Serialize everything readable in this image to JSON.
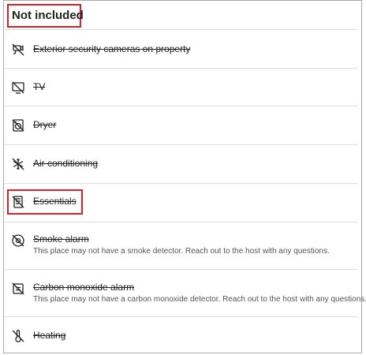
{
  "section": {
    "title": "Not included"
  },
  "items": [
    {
      "label": "Exterior security cameras on property",
      "icon": "camera-off-icon"
    },
    {
      "label": "TV",
      "icon": "tv-off-icon"
    },
    {
      "label": "Dryer",
      "icon": "dryer-off-icon"
    },
    {
      "label": "Air conditioning",
      "icon": "snowflake-off-icon"
    },
    {
      "label": "Essentials",
      "icon": "essentials-off-icon"
    },
    {
      "label": "Smoke alarm",
      "description": "This place may not have a smoke detector. Reach out to the host with any questions.",
      "icon": "smoke-alarm-off-icon"
    },
    {
      "label": "Carbon monoxide alarm",
      "description": "This place may not have a carbon monoxide detector. Reach out to the host with any questions.",
      "icon": "co-alarm-off-icon"
    },
    {
      "label": "Heating",
      "icon": "thermometer-off-icon"
    }
  ],
  "colors": {
    "highlight_border": "#d8202a",
    "divider": "#dddddd",
    "text": "#222222",
    "secondary_text": "#555555"
  }
}
